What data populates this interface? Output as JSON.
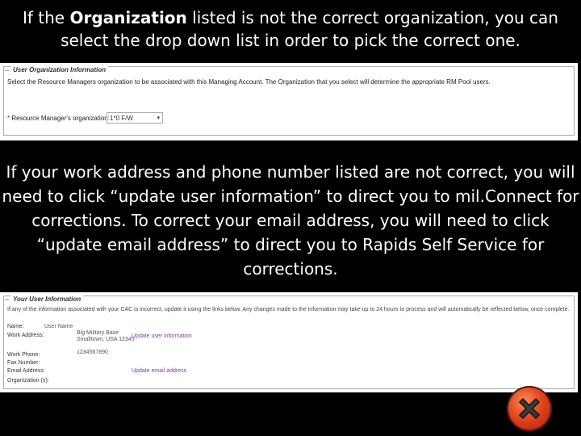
{
  "caption1": {
    "pre": "If the ",
    "bold": "Organization",
    "post": " listed is not the correct organization, you can select the drop down list in order to pick the correct one."
  },
  "caption2": "If your work address and phone number listed are not correct, you will need to click “update user information” to direct you to mil.Connect for corrections. To correct your email address, you will need to click “update email address” to direct you to Rapids Self Service for corrections.",
  "org_panel": {
    "minus": "−",
    "legend": "User Organization Information",
    "description": "Select the Resource Managers organization to be associated with this Managing Account. The Organization that you select will determine the appropriate RM Pool users.",
    "required_mark": "*",
    "field_label": "Resource Manager's organization:",
    "select_value": "1*0 F/W",
    "select_arrow": "▾"
  },
  "user_panel": {
    "minus": "−",
    "legend": "Your User Information",
    "description": "If any of the information associated with your CAC is incorrect, update it using the links below. Any changes made to the information may take up to 24 hours to process and will automatically be reflected below, once complete.",
    "fields": [
      {
        "label": "Name:",
        "value": "User Name"
      },
      {
        "label": "Work Address:",
        "value": "Big Military Base"
      },
      {
        "label": "",
        "value": "Smalltown, USA 12345"
      },
      {
        "label": "Work Phone:",
        "value": "1234567890"
      },
      {
        "label": "Fax Number:",
        "value": ""
      },
      {
        "label": "Email Address:",
        "value": ""
      },
      {
        "label": "Organization (s):",
        "value": ""
      }
    ],
    "update_user_link": "Update user information",
    "update_email_link": "Update email address"
  },
  "colors": {
    "background": "#000000",
    "link": "#7a3fa0",
    "required": "#cc0000",
    "close_button": "#e0431b"
  },
  "icons": {
    "close": "close-x-icon"
  }
}
